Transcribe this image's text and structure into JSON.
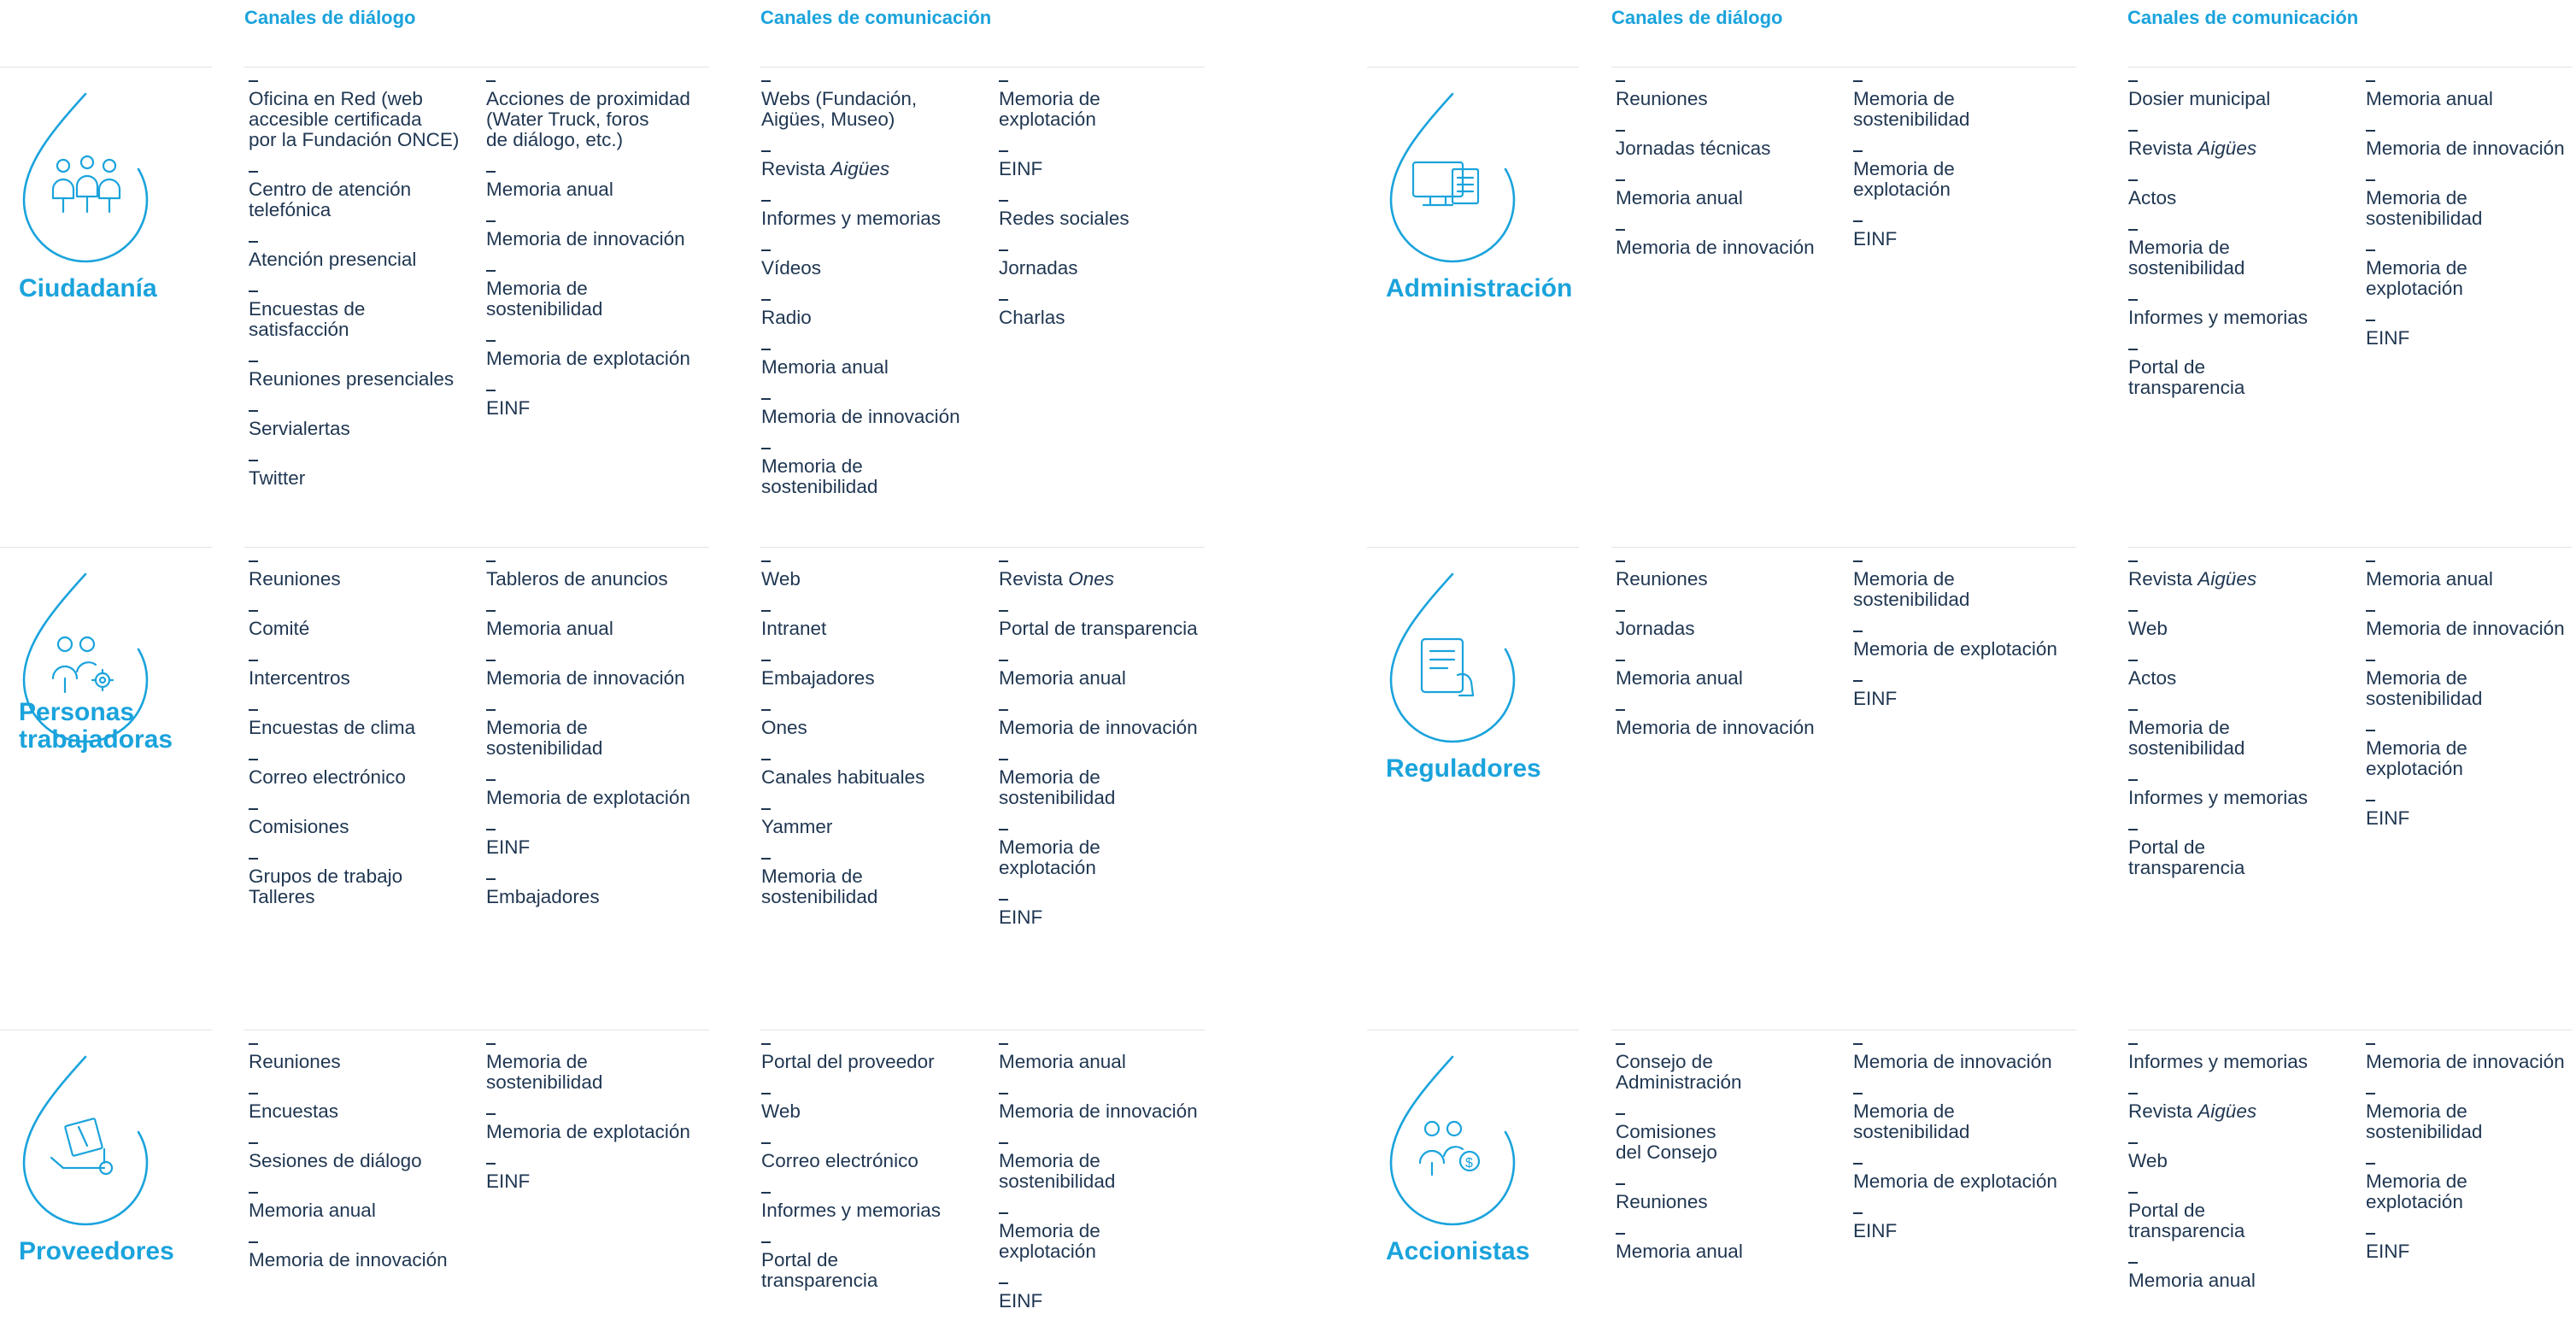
{
  "headers": {
    "dialogo": "Canales de diálogo",
    "comunicacion": "Canales de comunicación"
  },
  "groups": [
    {
      "label": "Ciudadanía",
      "icon": "people-group-icon",
      "dialogo_a": [
        "Oficina en Red (web\naccesible certificada\npor la Fundación ONCE)",
        "Centro de atención\ntelefónica",
        "Atención presencial",
        "Encuestas de\nsatisfacción",
        "Reuniones presenciales",
        "Servialertas",
        "Twitter"
      ],
      "dialogo_b": [
        "Acciones de proximidad\n(Water Truck, foros\nde diálogo, etc.)",
        "Memoria anual",
        "Memoria de innovación",
        "Memoria de\nsostenibilidad",
        "Memoria de explotación",
        "EINF"
      ],
      "comunicacion_a": [
        "Webs (Fundación,\nAigües, Museo)",
        "Revista |Aigües",
        "Informes y memorias",
        "Vídeos",
        "Radio",
        "Memoria anual",
        "Memoria de innovación",
        "Memoria de\nsostenibilidad"
      ],
      "comunicacion_b": [
        "Memoria de\nexplotación",
        "EINF",
        "Redes sociales",
        "Jornadas",
        "Charlas"
      ]
    },
    {
      "label": "Administración",
      "icon": "monitor-document-icon",
      "dialogo_a": [
        "Reuniones",
        "Jornadas técnicas",
        "Memoria anual",
        "Memoria de innovación"
      ],
      "dialogo_b": [
        "Memoria de\nsostenibilidad",
        "Memoria de\nexplotación",
        "EINF"
      ],
      "comunicacion_a": [
        "Dosier municipal",
        "Revista |Aigües",
        "Actos",
        "Memoria de\nsostenibilidad",
        "Informes y memorias",
        "Portal de\ntransparencia"
      ],
      "comunicacion_b": [
        "Memoria anual",
        "Memoria de innovación",
        "Memoria de\nsostenibilidad",
        "Memoria de\nexplotación",
        "EINF"
      ]
    },
    {
      "label": "Personas\ntrabajadoras",
      "icon": "people-gear-icon",
      "dialogo_a": [
        "Reuniones",
        "Comité",
        "Intercentros",
        "Encuestas de clima",
        "Correo electrónico",
        "Comisiones",
        "Grupos de trabajo\nTalleres"
      ],
      "dialogo_b": [
        "Tableros de anuncios",
        "Memoria anual",
        "Memoria de innovación",
        "Memoria de\nsostenibilidad",
        "Memoria de explotación",
        "EINF",
        "Embajadores"
      ],
      "comunicacion_a": [
        "Web",
        "Intranet",
        "Embajadores",
        "Ones",
        "Canales habituales",
        "Yammer",
        "Memoria de\nsostenibilidad"
      ],
      "comunicacion_b": [
        "Revista |Ones",
        "Portal de transparencia",
        "Memoria anual",
        "Memoria de innovación",
        "Memoria de\nsostenibilidad",
        "Memoria de\nexplotación",
        "EINF"
      ]
    },
    {
      "label": "Reguladores",
      "icon": "tablet-hand-icon",
      "dialogo_a": [
        "Reuniones",
        "Jornadas",
        "Memoria anual",
        "Memoria de innovación"
      ],
      "dialogo_b": [
        "Memoria de\nsostenibilidad",
        "Memoria de explotación",
        "EINF"
      ],
      "comunicacion_a": [
        "Revista |Aigües",
        "Web",
        "Actos",
        "Memoria de\nsostenibilidad",
        "Informes y memorias",
        "Portal de\ntransparencia"
      ],
      "comunicacion_b": [
        "Memoria anual",
        "Memoria de innovación",
        "Memoria de\nsostenibilidad",
        "Memoria de\nexplotación",
        "EINF"
      ]
    },
    {
      "label": "Proveedores",
      "icon": "hand-truck-box-icon",
      "dialogo_a": [
        "Reuniones",
        "Encuestas",
        "Sesiones de diálogo",
        "Memoria anual",
        "Memoria de innovación"
      ],
      "dialogo_b": [
        "Memoria de\nsostenibilidad",
        "Memoria de explotación",
        "EINF"
      ],
      "comunicacion_a": [
        "Portal del proveedor",
        "Web",
        "Correo electrónico",
        "Informes y memorias",
        "Portal de\ntransparencia"
      ],
      "comunicacion_b": [
        "Memoria anual",
        "Memoria de innovación",
        "Memoria de\nsostenibilidad",
        "Memoria de\nexplotación",
        "EINF"
      ]
    },
    {
      "label": "Accionistas",
      "icon": "people-coin-icon",
      "dialogo_a": [
        "Consejo de\nAdministración",
        "Comisiones\ndel Consejo",
        "Reuniones",
        "Memoria anual"
      ],
      "dialogo_b": [
        "Memoria de innovación",
        "Memoria de\nsostenibilidad",
        "Memoria de explotación",
        "EINF"
      ],
      "comunicacion_a": [
        "Informes y memorias",
        "Revista |Aigües",
        "Web",
        "Portal de\ntransparencia",
        "Memoria anual"
      ],
      "comunicacion_b": [
        "Memoria de innovación",
        "Memoria de\nsostenibilidad",
        "Memoria de\nexplotación",
        "EINF"
      ]
    }
  ]
}
